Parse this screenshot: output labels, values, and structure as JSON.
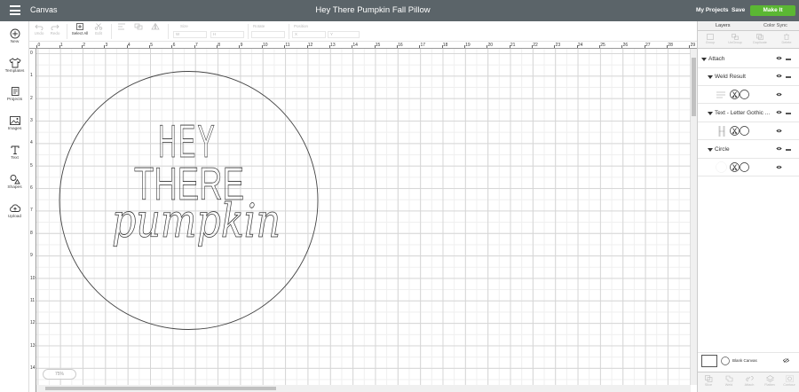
{
  "header": {
    "canvas_label": "Canvas",
    "project_title": "Hey There Pumpkin Fall Pillow",
    "my_projects": "My Projects",
    "save": "Save",
    "make_it": "Make It"
  },
  "sidebar": {
    "items": [
      {
        "label": "New",
        "icon": "plus-circle-icon"
      },
      {
        "label": "Templates",
        "icon": "shirt-icon"
      },
      {
        "label": "Projects",
        "icon": "projects-icon"
      },
      {
        "label": "Images",
        "icon": "images-icon"
      },
      {
        "label": "Text",
        "icon": "text-icon"
      },
      {
        "label": "Shapes",
        "icon": "shapes-icon"
      },
      {
        "label": "Upload",
        "icon": "upload-cloud-icon"
      }
    ]
  },
  "toolbar": {
    "undo": "Undo",
    "redo": "Redo",
    "select_all": "Select All",
    "edit": "Edit",
    "size_label": "Size",
    "w_label": "W",
    "h_label": "H",
    "rotate_label": "Rotate",
    "position_label": "Position",
    "x_label": "X",
    "y_label": "Y"
  },
  "rulers": {
    "top": [
      "0",
      "1",
      "2",
      "3",
      "4",
      "5",
      "6",
      "7",
      "8",
      "9",
      "10",
      "11",
      "12",
      "13",
      "14",
      "15",
      "16",
      "17",
      "18",
      "19",
      "20",
      "21",
      "22",
      "23",
      "24",
      "25",
      "26",
      "27",
      "28",
      "29"
    ],
    "left": [
      "0",
      "1",
      "2",
      "3",
      "4",
      "5",
      "6",
      "7",
      "8",
      "9",
      "10",
      "11",
      "12",
      "13",
      "14"
    ]
  },
  "design": {
    "line1": "HEY",
    "line2": "THERE",
    "line3": "pumpkin"
  },
  "panel": {
    "tabs": [
      "Layers",
      "Color Sync"
    ],
    "tools": [
      "Group",
      "UnGroup",
      "Duplicate",
      "Delete"
    ],
    "layers": [
      {
        "name": "Attach",
        "level": 0
      },
      {
        "name": "Weld Result",
        "level": 1
      },
      {
        "name": "Text - Letter Gothic ...",
        "level": 1
      },
      {
        "name": "Circle",
        "level": 1
      }
    ],
    "blank_canvas": "Blank Canvas",
    "bottom_tools": [
      "Slice",
      "Weld",
      "Attach",
      "Flatten",
      "Contour"
    ]
  },
  "zoom": {
    "label": "75%"
  },
  "colors": {
    "topbar": "#5b6469",
    "make_it": "#5bb733"
  }
}
